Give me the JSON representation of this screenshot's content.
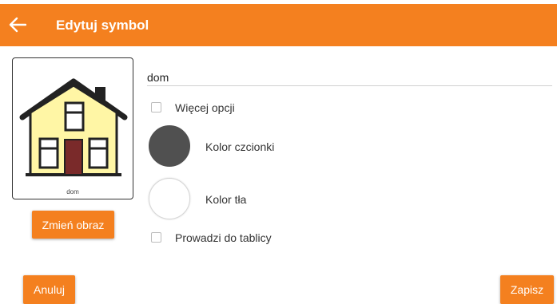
{
  "app_bar": {
    "title": "Edytuj symbol",
    "back_icon": "arrow-left-icon",
    "color": "#F4801F"
  },
  "symbol": {
    "caption": "dom",
    "image": "house-illustration",
    "change_image_label": "Zmień obraz"
  },
  "form": {
    "name_value": "dom",
    "more_options_label": "Więcej opcji",
    "more_options_checked": false,
    "font_color_label": "Kolor czcionki",
    "font_color": "#505050",
    "background_color_label": "Kolor tła",
    "background_color": "#FFFFFF",
    "leads_to_board_label": "Prowadzi do tablicy",
    "leads_to_board_checked": false
  },
  "actions": {
    "cancel_label": "Anuluj",
    "save_label": "Zapisz"
  }
}
